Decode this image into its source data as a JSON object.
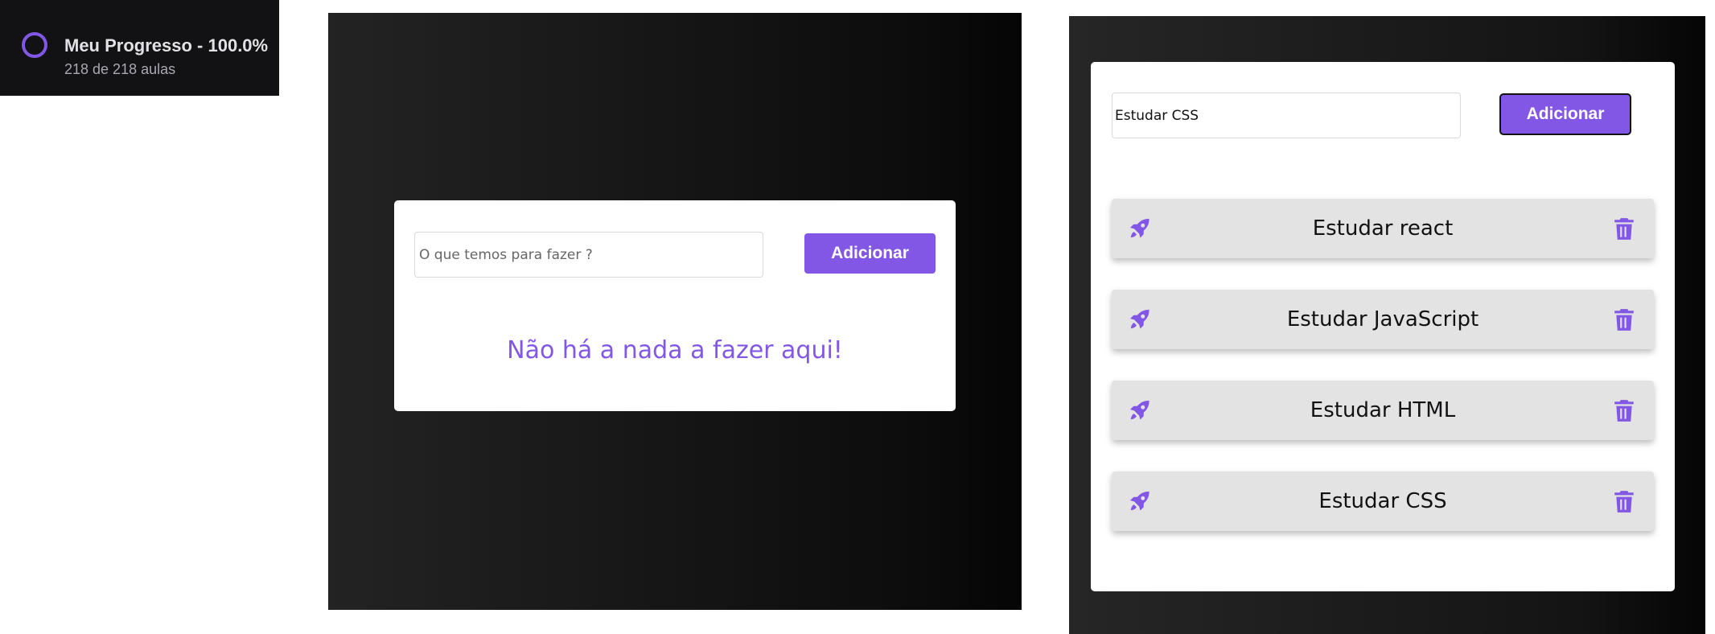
{
  "progress": {
    "title": "Meu Progresso - 100.0%",
    "subtitle": "218 de 218 aulas",
    "percent": 100
  },
  "empty_app": {
    "input_placeholder": "O que temos para fazer ?",
    "add_button_label": "Adicionar",
    "empty_message": "Não há a nada a fazer aqui!"
  },
  "list_app": {
    "input_value": "Estudar CSS",
    "add_button_label": "Adicionar",
    "tasks": [
      {
        "label": "Estudar react",
        "icon": "rocket-icon",
        "delete_icon": "trash-icon"
      },
      {
        "label": "Estudar JavaScript",
        "icon": "rocket-icon",
        "delete_icon": "trash-icon"
      },
      {
        "label": "Estudar HTML",
        "icon": "rocket-icon",
        "delete_icon": "trash-icon"
      },
      {
        "label": "Estudar CSS",
        "icon": "rocket-icon",
        "delete_icon": "trash-icon"
      }
    ]
  },
  "colors": {
    "accent": "#8257e5",
    "dark": "#121214",
    "task_bg": "#e3e3e3"
  }
}
